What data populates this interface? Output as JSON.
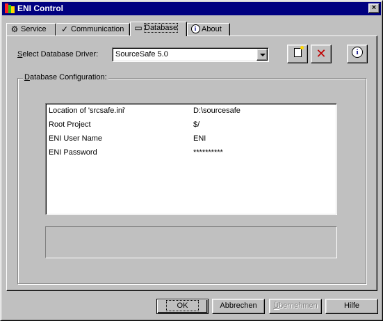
{
  "window": {
    "title": "ENI Control",
    "close_glyph": "×"
  },
  "tabs": [
    {
      "label": "Service",
      "icon": "gears-icon",
      "glyph": "⚙"
    },
    {
      "label": "Communication",
      "icon": "flag-icon",
      "glyph": "✓"
    },
    {
      "label": "Database",
      "icon": "database-icon",
      "glyph": "▭",
      "active": true
    },
    {
      "label": "About",
      "icon": "info-icon",
      "glyph": "i"
    }
  ],
  "driver": {
    "label_accel": "S",
    "label_rest": "elect Database Driver:",
    "selected": "SourceSafe 5.0"
  },
  "toolbar": {
    "new_icon": "new-document-icon",
    "delete_glyph": "✕",
    "info_glyph": "i"
  },
  "group": {
    "legend_accel": "D",
    "legend_rest": "atabase Configuration:"
  },
  "config": {
    "rows": [
      {
        "key": "Location of 'srcsafe.ini'",
        "value": "D:\\sourcesafe"
      },
      {
        "key": "Root Project",
        "value": "$/"
      },
      {
        "key": "ENI User Name",
        "value": "ENI"
      },
      {
        "key": "ENI Password",
        "value": "**********"
      }
    ]
  },
  "buttons": {
    "ok": "OK",
    "cancel": "Abbrechen",
    "apply_accel": "Ü",
    "apply_rest": "bernehmen",
    "help": "Hilfe"
  },
  "colors": {
    "titlebar": "#000080",
    "face": "#c0c0c0",
    "disabled_text": "#808080"
  }
}
